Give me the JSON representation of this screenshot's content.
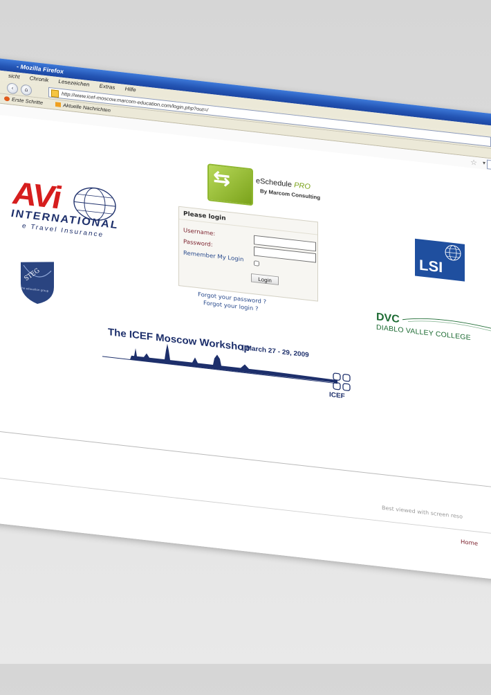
{
  "browser": {
    "title": "- Mozilla Firefox",
    "menu": [
      "sicht",
      "Chronik",
      "Lesezeichen",
      "Extras",
      "Hilfe"
    ],
    "url": "http://www.icef-moscow.marcom-education.com/login.php?out=/",
    "bookmarks": [
      "Erste Schritte",
      "Aktuelle Nachrichten"
    ]
  },
  "logos": {
    "eschedule_name": "eSchedule",
    "eschedule_pro": "PRO",
    "eschedule_by": "By Marcom Consulting",
    "avi_big": "AVi",
    "avi_intl": "INTERNATIONAL",
    "avi_tag": "e Travel Insurance",
    "lsi": "LSI",
    "dvc_big": "DVC",
    "dvc_sub": "DIABLO VALLEY COLLEGE",
    "steg_letters": "STEG",
    "steg_sub": "the education group"
  },
  "login": {
    "title": "Please login",
    "username_label": "Username:",
    "password_label": "Password:",
    "remember_label": "Remember My Login",
    "button": "Login",
    "forgot_password": "Forgot your password ?",
    "forgot_login": "Forgot your login ?"
  },
  "icef": {
    "title": "The ICEF Moscow Workshop",
    "date": "| March 27 - 29, 2009",
    "logo_text": "ICEF"
  },
  "footer": {
    "best_viewed": "Best viewed with screen reso",
    "home": "Home"
  },
  "colors": {
    "titlebar": "#2455b4",
    "accent_green": "#7aa21a",
    "avi_red": "#d61e1e",
    "navy": "#1d2f6b",
    "lsi_blue": "#1f4f9f",
    "dvc_green": "#1d6b33"
  }
}
